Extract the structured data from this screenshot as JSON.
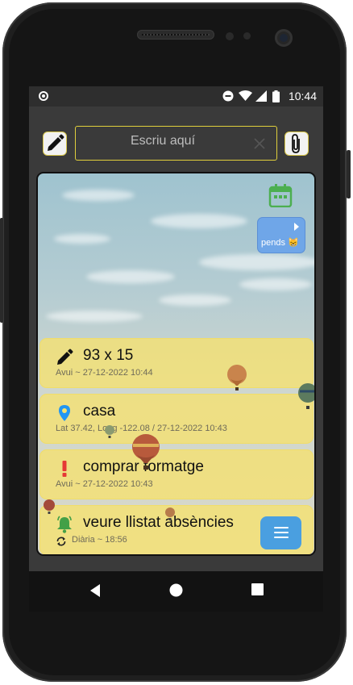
{
  "status_bar": {
    "time": "10:44",
    "icons": [
      "circle-icon",
      "do-not-disturb-icon",
      "wifi-icon",
      "signal-icon",
      "battery-icon"
    ]
  },
  "toolbar": {
    "search_placeholder": "Escriu aquí",
    "search_value": ""
  },
  "panel": {
    "pends_label": "pends 😸"
  },
  "notes": [
    {
      "icon": "pencil-icon",
      "title": "93 x 15",
      "meta": "Avui ~ 27-12-2022  10:44"
    },
    {
      "icon": "location-pin-icon",
      "title": "casa",
      "meta": "Lat 37.42, Long -122.08 / 27-12-2022 10:43"
    },
    {
      "icon": "exclamation-icon",
      "title": "comprar formatge",
      "meta": "Avui ~ 27-12-2022  10:43"
    },
    {
      "icon": "bell-icon",
      "title": "veure llistat absències",
      "meta": "Diària ~ 18:56",
      "meta_icon": "repeat-icon"
    }
  ],
  "colors": {
    "note_background": "#f6e26e",
    "accent_border": "#e0cf3c",
    "pends_button": "#6fa6e8",
    "menu_button": "#4a9fe0",
    "calendar_icon": "#4caf50",
    "location_icon": "#2196f3",
    "exclamation_icon": "#e53935",
    "bell_icon": "#43a047"
  }
}
